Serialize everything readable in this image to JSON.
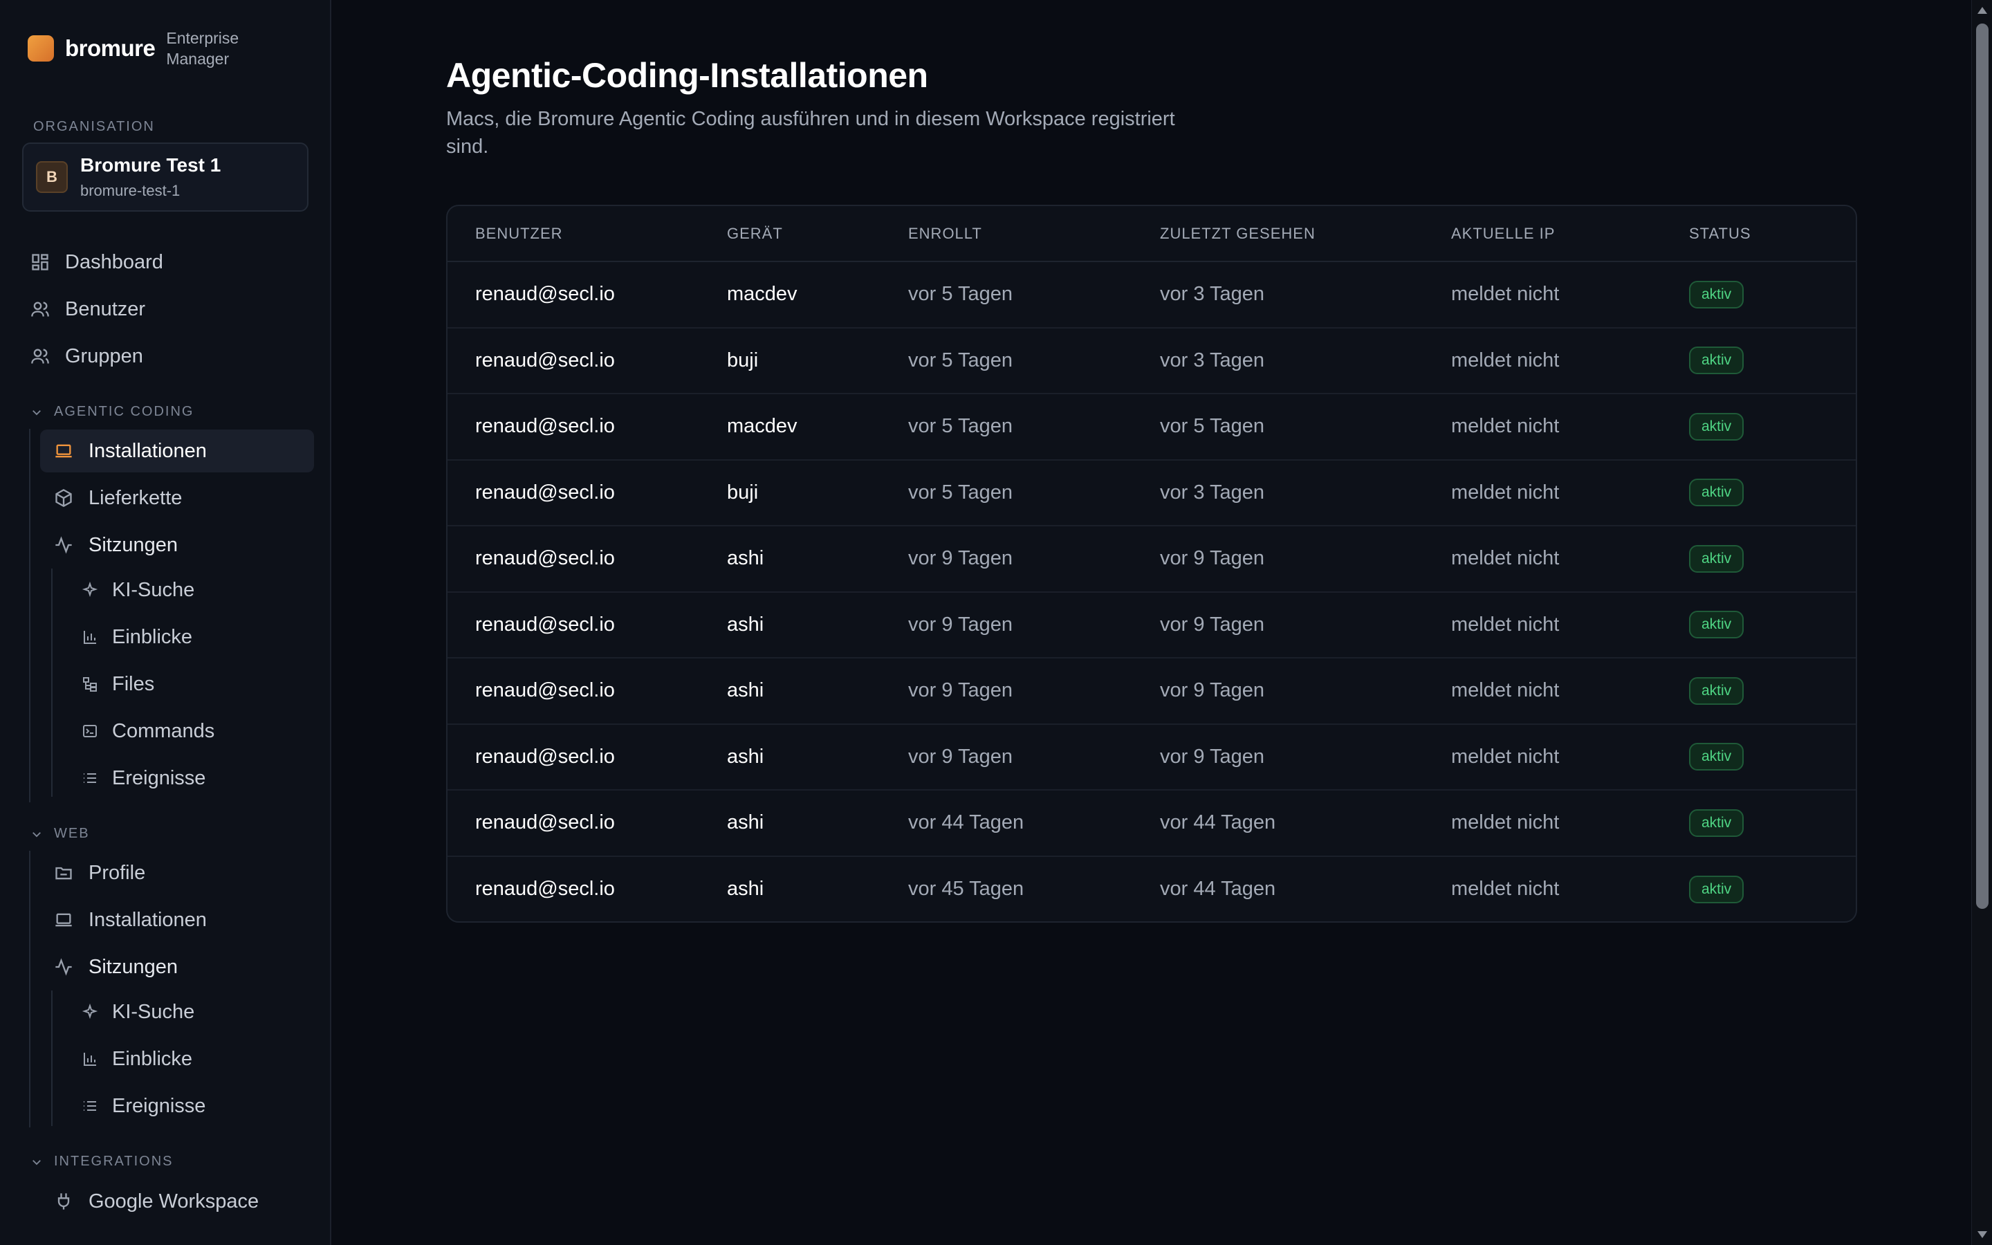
{
  "brand": {
    "name": "bromure",
    "subtitle": "Enterprise Manager"
  },
  "organization": {
    "section_label": "ORGANISATION",
    "avatar_letter": "B",
    "name": "Bromure Test 1",
    "slug": "bromure-test-1"
  },
  "nav": {
    "dashboard": "Dashboard",
    "users": "Benutzer",
    "groups": "Gruppen",
    "agentic": {
      "label": "AGENTIC CODING",
      "installations": "Installationen",
      "supply_chain": "Lieferkette",
      "sessions": "Sitzungen",
      "ai_search": "KI-Suche",
      "insights": "Einblicke",
      "files": "Files",
      "commands": "Commands",
      "events": "Ereignisse"
    },
    "web": {
      "label": "WEB",
      "profiles": "Profile",
      "installations": "Installationen",
      "sessions": "Sitzungen",
      "ai_search": "KI-Suche",
      "insights": "Einblicke",
      "events": "Ereignisse"
    },
    "integrations": {
      "label": "INTEGRATIONS",
      "google_workspace": "Google Workspace"
    }
  },
  "page": {
    "title": "Agentic-Coding-Installationen",
    "subtitle": "Macs, die Bromure Agentic Coding ausführen und in diesem Workspace registriert sind."
  },
  "table": {
    "headers": [
      "BENUTZER",
      "GERÄT",
      "ENROLLT",
      "ZULETZT GESEHEN",
      "AKTUELLE IP",
      "STATUS"
    ],
    "rows": [
      {
        "user": "renaud@secl.io",
        "device": "macdev",
        "enrolled": "vor 5 Tagen",
        "last_seen": "vor 3 Tagen",
        "ip": "meldet nicht",
        "status": "aktiv"
      },
      {
        "user": "renaud@secl.io",
        "device": "buji",
        "enrolled": "vor 5 Tagen",
        "last_seen": "vor 3 Tagen",
        "ip": "meldet nicht",
        "status": "aktiv"
      },
      {
        "user": "renaud@secl.io",
        "device": "macdev",
        "enrolled": "vor 5 Tagen",
        "last_seen": "vor 5 Tagen",
        "ip": "meldet nicht",
        "status": "aktiv"
      },
      {
        "user": "renaud@secl.io",
        "device": "buji",
        "enrolled": "vor 5 Tagen",
        "last_seen": "vor 3 Tagen",
        "ip": "meldet nicht",
        "status": "aktiv"
      },
      {
        "user": "renaud@secl.io",
        "device": "ashi",
        "enrolled": "vor 9 Tagen",
        "last_seen": "vor 9 Tagen",
        "ip": "meldet nicht",
        "status": "aktiv"
      },
      {
        "user": "renaud@secl.io",
        "device": "ashi",
        "enrolled": "vor 9 Tagen",
        "last_seen": "vor 9 Tagen",
        "ip": "meldet nicht",
        "status": "aktiv"
      },
      {
        "user": "renaud@secl.io",
        "device": "ashi",
        "enrolled": "vor 9 Tagen",
        "last_seen": "vor 9 Tagen",
        "ip": "meldet nicht",
        "status": "aktiv"
      },
      {
        "user": "renaud@secl.io",
        "device": "ashi",
        "enrolled": "vor 9 Tagen",
        "last_seen": "vor 9 Tagen",
        "ip": "meldet nicht",
        "status": "aktiv"
      },
      {
        "user": "renaud@secl.io",
        "device": "ashi",
        "enrolled": "vor 44 Tagen",
        "last_seen": "vor 44 Tagen",
        "ip": "meldet nicht",
        "status": "aktiv"
      },
      {
        "user": "renaud@secl.io",
        "device": "ashi",
        "enrolled": "vor 45 Tagen",
        "last_seen": "vor 44 Tagen",
        "ip": "meldet nicht",
        "status": "aktiv"
      }
    ]
  },
  "colors": {
    "accent": "#f0943c",
    "status_active": "#4fd584",
    "background": "#090c13"
  }
}
